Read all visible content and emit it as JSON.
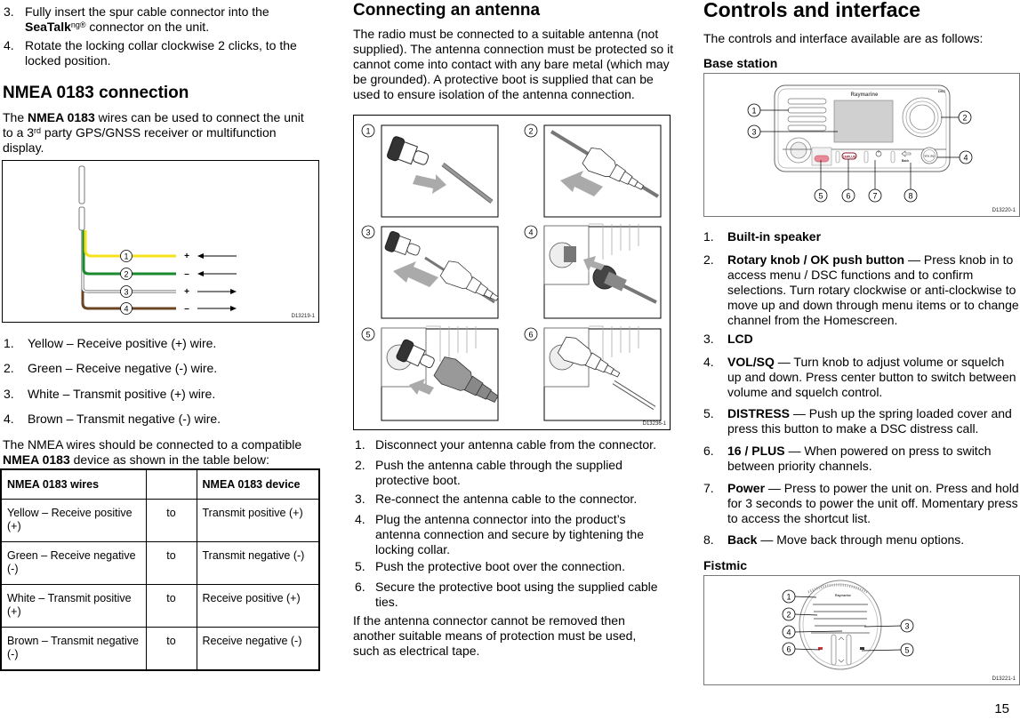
{
  "page_number": "15",
  "column1": {
    "steps_continued": [
      {
        "num": "3.",
        "text_pre": "Fully insert the spur cable connector into the ",
        "bold": "SeaTalk",
        "sup": "ng®",
        "text_post": " connector on the unit."
      },
      {
        "num": "4.",
        "text": "Rotate the locking collar clockwise 2 clicks, to the locked position."
      }
    ],
    "heading": "NMEA 0183 connection",
    "intro": {
      "pre": "The ",
      "bold": "NMEA 0183",
      "mid": " wires can be used to connect the unit to a 3",
      "sup": "rd",
      "post": " party GPS/GNSS receiver or multifunction display."
    },
    "figure": {
      "id": "D13219-1",
      "wires": [
        {
          "num": "1",
          "color": "#f5e11a",
          "sign": "+",
          "direction": "in"
        },
        {
          "num": "2",
          "color": "#1a8a2e",
          "sign": "–",
          "direction": "in"
        },
        {
          "num": "3",
          "color": "#ffffff",
          "sign": "+",
          "direction": "out"
        },
        {
          "num": "4",
          "color": "#6b4423",
          "sign": "–",
          "direction": "out"
        }
      ]
    },
    "wire_list": [
      {
        "num": "1.",
        "text": "Yellow – Receive positive (+) wire."
      },
      {
        "num": "2.",
        "text": "Green – Receive negative (-) wire."
      },
      {
        "num": "3.",
        "text": "White – Transmit positive (+) wire."
      },
      {
        "num": "4.",
        "text": "Brown – Transmit negative (-) wire."
      }
    ],
    "table_intro": {
      "pre": "The NMEA wires should be connected to a compatible ",
      "bold": "NMEA 0183",
      "post": " device as shown in the table below:"
    },
    "table": {
      "headers": [
        "NMEA 0183 wires",
        "",
        "NMEA 0183 device"
      ],
      "rows": [
        [
          "Yellow – Receive positive (+)",
          "to",
          "Transmit positive (+)"
        ],
        [
          "Green – Receive negative (-)",
          "to",
          "Transmit negative (-)"
        ],
        [
          "White – Transmit positive (+)",
          "to",
          "Receive positive (+)"
        ],
        [
          "Brown – Transmit negative (-)",
          "to",
          "Receive negative (-)"
        ]
      ]
    }
  },
  "column2": {
    "heading": "Connecting an antenna",
    "intro": "The radio must be connected to a suitable antenna (not supplied). The antenna connection must be protected so it cannot come into contact with any bare metal (which may be grounded). A protective boot is supplied that can be used to ensure isolation of the antenna connection.",
    "figure": {
      "id": "D13236-1",
      "panels": [
        "1",
        "2",
        "3",
        "4",
        "5",
        "6"
      ]
    },
    "steps": [
      {
        "num": "1.",
        "text": "Disconnect your antenna cable from the connector."
      },
      {
        "num": "2.",
        "text": "Push the antenna cable through the supplied protective boot."
      },
      {
        "num": "3.",
        "text": "Re-connect the antenna cable to the connector."
      },
      {
        "num": "4.",
        "text": "Plug the antenna connector into the product’s antenna connection and secure by tightening the locking collar."
      },
      {
        "num": "5.",
        "text": "Push the protective boot over the connection."
      },
      {
        "num": "6.",
        "text": "Secure the protective boot using the supplied cable ties."
      }
    ],
    "note": "If the antenna connector cannot be removed then another suitable means of protection must be used, such as electrical tape."
  },
  "column3": {
    "heading": "Controls and interface",
    "intro": "The controls and interface available are as follows:",
    "base_station": {
      "subheading": "Base station",
      "figure": {
        "id": "D13220-1",
        "brand": "Raymarine",
        "callouts": [
          "1",
          "2",
          "3",
          "4",
          "5",
          "6",
          "7",
          "8"
        ],
        "button_labels": {
          "distress": "DISTRESS",
          "plus": "16/PLUS",
          "back": "Back",
          "vol": "VOL SQ"
        }
      },
      "items": [
        {
          "num": "1.",
          "bold": "Built-in speaker",
          "text": ""
        },
        {
          "num": "2.",
          "bold": "Rotary knob / OK push button",
          "text": " — Press knob in to access menu / DSC functions and to confirm selections. Turn rotary clockwise or anti-clockwise to move up and down through menu items or to change channel from the Homescreen."
        },
        {
          "num": "3.",
          "bold": "LCD",
          "text": ""
        },
        {
          "num": "4.",
          "bold": "VOL/SQ",
          "text": " — Turn knob to adjust volume or squelch up and down. Press center button to switch between volume and squelch control."
        },
        {
          "num": "5.",
          "bold": "DISTRESS",
          "text": " — Push up the spring loaded cover and press this button to make a DSC distress call."
        },
        {
          "num": "6.",
          "bold": "16 / PLUS",
          "text": " — When powered on press to switch between priority channels."
        },
        {
          "num": "7.",
          "bold": "Power",
          "text": " — Press to power the unit on. Press and hold for 3 seconds to power the unit off. Momentary press to access the shortcut list."
        },
        {
          "num": "8.",
          "bold": "Back",
          "text": " — Move back through menu options."
        }
      ]
    },
    "fistmic": {
      "subheading": "Fistmic",
      "figure": {
        "id": "D13221-1",
        "callouts": [
          "1",
          "2",
          "3",
          "4",
          "5",
          "6"
        ]
      }
    }
  }
}
